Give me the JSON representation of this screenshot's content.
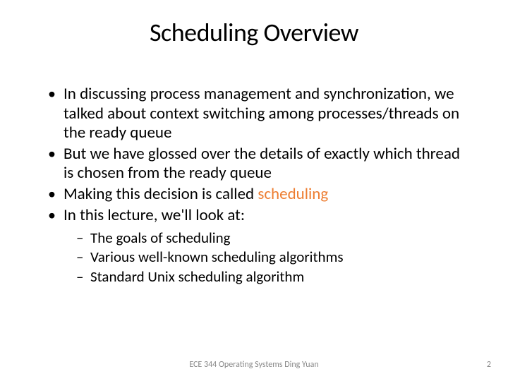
{
  "title": "Scheduling Overview",
  "bullets": [
    {
      "text": "In discussing process management and synchronization, we talked about context switching among processes/threads on the ready queue"
    },
    {
      "text": "But we have glossed over the details of exactly which thread is chosen from the ready queue"
    },
    {
      "prefix": "Making this decision is called ",
      "highlight": "scheduling"
    },
    {
      "text": "In this lecture, we'll look at:"
    }
  ],
  "sub_bullets": [
    "The goals of scheduling",
    "Various well-known scheduling algorithms",
    "Standard Unix scheduling algorithm"
  ],
  "footer": "ECE 344 Operating Systems Ding Yuan",
  "page_number": "2"
}
